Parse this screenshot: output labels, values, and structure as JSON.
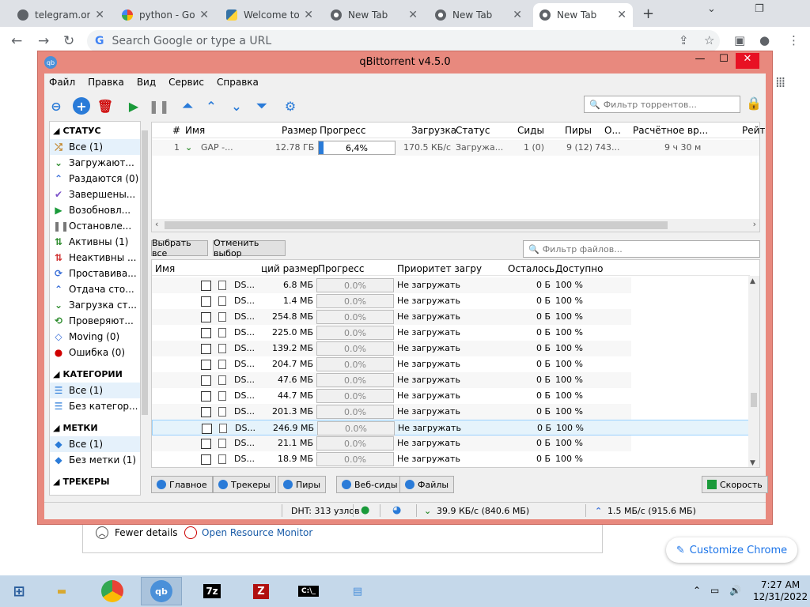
{
  "chrome": {
    "tabs": [
      {
        "title": "telegram.org",
        "icon": "globe-icon"
      },
      {
        "title": "python - Goo",
        "icon": "google-icon"
      },
      {
        "title": "Welcome to",
        "icon": "python-icon"
      },
      {
        "title": "New Tab",
        "icon": "chrome-icon"
      },
      {
        "title": "New Tab",
        "icon": "chrome-icon"
      },
      {
        "title": "New Tab",
        "icon": "chrome-icon",
        "active": true
      }
    ],
    "omnibox_placeholder": "Search Google or type a URL",
    "customize_label": "Customize Chrome",
    "fewer_details": "Fewer details",
    "resource_monitor": "Open Resource Monitor"
  },
  "qb": {
    "title": "qBittorrent v4.5.0",
    "menu": [
      "Файл",
      "Правка",
      "Вид",
      "Сервис",
      "Справка"
    ],
    "torrent_filter_placeholder": "Фильтр торрентов...",
    "sidebar": {
      "status_header": "СТАТУС",
      "status_items": [
        {
          "label": "Все (1)",
          "icon": "shuffle-icon",
          "color": "#c08020"
        },
        {
          "label": "Загружают...",
          "icon": "download-icon",
          "color": "#2a8a2a"
        },
        {
          "label": "Раздаются (0)",
          "icon": "upload-icon",
          "color": "#3a6fd8"
        },
        {
          "label": "Завершены...",
          "icon": "check-icon",
          "color": "#7a4fc8"
        },
        {
          "label": "Возобновл...",
          "icon": "play-icon",
          "color": "#1a9a3a"
        },
        {
          "label": "Остановле...",
          "icon": "pause-icon",
          "color": "#777777"
        },
        {
          "label": "Активны (1)",
          "icon": "active-icon",
          "color": "#2a8a2a"
        },
        {
          "label": "Неактивны ...",
          "icon": "inactive-icon",
          "color": "#d03030"
        },
        {
          "label": "Проставива...",
          "icon": "stalled-icon",
          "color": "#3a6fd8"
        },
        {
          "label": "Отдача сто...",
          "icon": "stalled-up-icon",
          "color": "#3a6fd8"
        },
        {
          "label": "Загрузка ст...",
          "icon": "stalled-down-icon",
          "color": "#2a8a2a"
        },
        {
          "label": "Проверяют...",
          "icon": "refresh-icon",
          "color": "#2a8a2a"
        },
        {
          "label": "Moving (0)",
          "icon": "moving-icon",
          "color": "#3a6fd8"
        },
        {
          "label": "Ошибка (0)",
          "icon": "error-icon",
          "color": "#d00000"
        }
      ],
      "categories_header": "КАТЕГОРИИ",
      "category_items": [
        {
          "label": "Все (1)"
        },
        {
          "label": "Без категор..."
        }
      ],
      "tags_header": "МЕТКИ",
      "tag_items": [
        {
          "label": "Все (1)"
        },
        {
          "label": "Без метки (1)"
        }
      ],
      "trackers_header": "ТРЕКЕРЫ"
    },
    "torrents": {
      "columns": [
        "#",
        "Имя",
        "Размер",
        "Прогресс",
        "Загрузка",
        "Статус",
        "Сиды",
        "Пиры",
        "О...",
        "Расчётное вр...",
        "Рейт"
      ],
      "rows": [
        {
          "num": "1",
          "name": "GAP -...",
          "size": "12.78 ГБ",
          "progress": 0.064,
          "progress_label": "6,4%",
          "dl": "170.5 КБ/с",
          "status": "Загружа...",
          "seeds": "1 (0)",
          "peers": "9 (12)",
          "other": "743...",
          "eta": "9 ч 30 м"
        }
      ]
    },
    "select_all": "Выбрать все",
    "deselect": "Отменить выбор",
    "file_filter_placeholder": "Фильтр файлов...",
    "files": {
      "columns": [
        "Имя",
        "ций размер",
        "Прогресс",
        "Приоритет загру",
        "Осталось",
        "Доступно"
      ],
      "rows": [
        {
          "name": "DS...",
          "size": "6.8 МБ",
          "progress": "0.0%",
          "priority": "Не загружать",
          "remaining": "0 Б",
          "avail": "100 %"
        },
        {
          "name": "DS...",
          "size": "1.4 МБ",
          "progress": "0.0%",
          "priority": "Не загружать",
          "remaining": "0 Б",
          "avail": "100 %"
        },
        {
          "name": "DS...",
          "size": "254.8 МБ",
          "progress": "0.0%",
          "priority": "Не загружать",
          "remaining": "0 Б",
          "avail": "100 %"
        },
        {
          "name": "DS...",
          "size": "225.0 МБ",
          "progress": "0.0%",
          "priority": "Не загружать",
          "remaining": "0 Б",
          "avail": "100 %"
        },
        {
          "name": "DS...",
          "size": "139.2 МБ",
          "progress": "0.0%",
          "priority": "Не загружать",
          "remaining": "0 Б",
          "avail": "100 %"
        },
        {
          "name": "DS...",
          "size": "204.7 МБ",
          "progress": "0.0%",
          "priority": "Не загружать",
          "remaining": "0 Б",
          "avail": "100 %"
        },
        {
          "name": "DS...",
          "size": "47.6 МБ",
          "progress": "0.0%",
          "priority": "Не загружать",
          "remaining": "0 Б",
          "avail": "100 %"
        },
        {
          "name": "DS...",
          "size": "44.7 МБ",
          "progress": "0.0%",
          "priority": "Не загружать",
          "remaining": "0 Б",
          "avail": "100 %"
        },
        {
          "name": "DS...",
          "size": "201.3 МБ",
          "progress": "0.0%",
          "priority": "Не загружать",
          "remaining": "0 Б",
          "avail": "100 %"
        },
        {
          "name": "DS...",
          "size": "246.9 МБ",
          "progress": "0.0%",
          "priority": "Не загружать",
          "remaining": "0 Б",
          "avail": "100 %",
          "selected": true
        },
        {
          "name": "DS...",
          "size": "21.1 МБ",
          "progress": "0.0%",
          "priority": "Не загружать",
          "remaining": "0 Б",
          "avail": "100 %"
        },
        {
          "name": "DS...",
          "size": "18.9 МБ",
          "progress": "0.0%",
          "priority": "Не загружать",
          "remaining": "0 Б",
          "avail": "100 %"
        }
      ]
    },
    "bottom_tabs": [
      {
        "label": "Главное",
        "icon": "info-icon"
      },
      {
        "label": "Трекеры",
        "icon": "pin-icon"
      },
      {
        "label": "Пиры",
        "icon": "people-icon"
      },
      {
        "label": "Веб-сиды",
        "icon": "server-icon"
      },
      {
        "label": "Файлы",
        "icon": "folder-icon"
      }
    ],
    "speed_button": "Скорость",
    "status": {
      "dht": "DHT: 313 узлов",
      "down": "39.9 КБ/с (840.6 МБ)",
      "up": "1.5 МБ/с (915.6 МБ)"
    }
  },
  "taskbar": {
    "time": "7:27 AM",
    "date": "12/31/2022"
  }
}
